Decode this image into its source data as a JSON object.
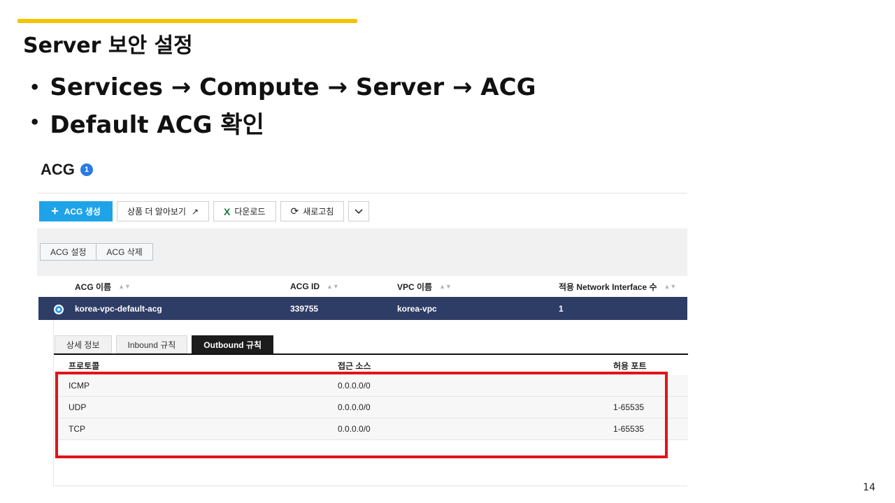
{
  "slide": {
    "title": "Server 보안 설정",
    "bullets": [
      "Services → Compute → Server → ACG",
      "Default ACG 확인"
    ],
    "page_number": "14"
  },
  "console": {
    "title": "ACG",
    "count": "1",
    "toolbar": {
      "create": "ACG 생성",
      "learn_more": "상품 더 알아보기",
      "download": "다운로드",
      "refresh": "새로고침"
    },
    "actions": {
      "settings": "ACG 설정",
      "delete": "ACG 삭제"
    },
    "table": {
      "columns": [
        "ACG 이름",
        "ACG ID",
        "VPC 이름",
        "적용 Network Interface 수"
      ],
      "row": {
        "name": "korea-vpc-default-acg",
        "id": "339755",
        "vpc": "korea-vpc",
        "ni_count": "1"
      }
    },
    "tabs": [
      "상세 정보",
      "Inbound 규칙",
      "Outbound 규칙"
    ],
    "active_tab": "Outbound 규칙",
    "rules": {
      "columns": [
        "프로토콜",
        "접근 소스",
        "허용 포트"
      ],
      "rows": [
        {
          "protocol": "ICMP",
          "source": "0.0.0.0/0",
          "port": ""
        },
        {
          "protocol": "UDP",
          "source": "0.0.0.0/0",
          "port": "1-65535"
        },
        {
          "protocol": "TCP",
          "source": "0.0.0.0/0",
          "port": "1-65535"
        }
      ]
    }
  },
  "colors": {
    "accent_bar": "#f5c400",
    "primary_button": "#1fa3e8",
    "selected_row": "#2e3d66",
    "highlight_box": "#e0141a"
  }
}
